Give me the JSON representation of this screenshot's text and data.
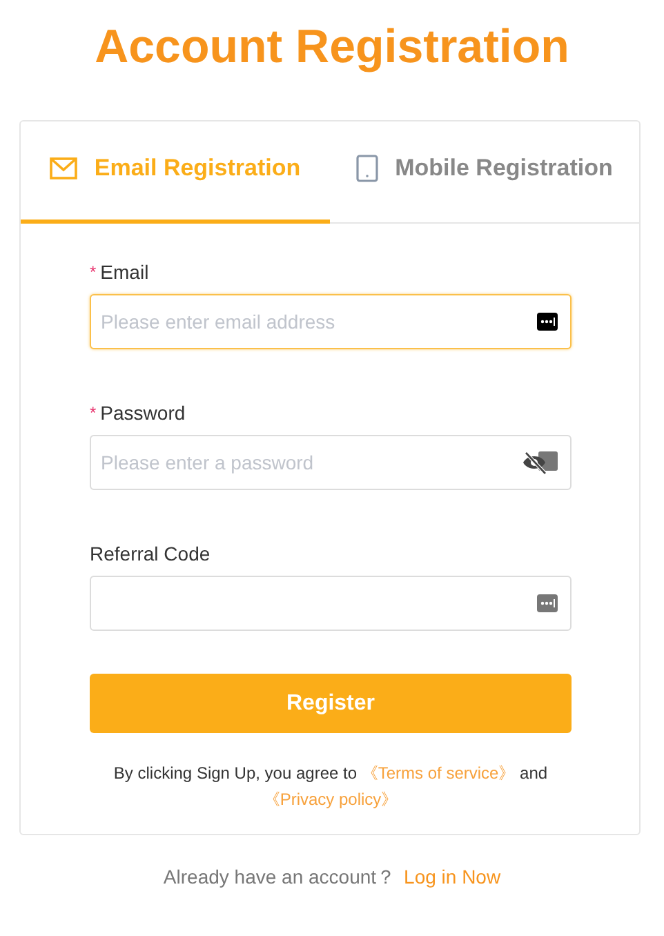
{
  "title": "Account Registration",
  "tabs": [
    {
      "label": "Email Registration",
      "selected": true
    },
    {
      "label": "Mobile Registration",
      "selected": false
    }
  ],
  "required_mark": "*",
  "fields": [
    {
      "label": "Email",
      "required": true,
      "placeholder": "Please enter email address",
      "kind": "text",
      "focused": true
    },
    {
      "label": "Password",
      "required": true,
      "placeholder": "Please enter a password",
      "kind": "password",
      "focused": false
    },
    {
      "label": "Referral Code",
      "required": false,
      "kind": "text",
      "focused": false
    }
  ],
  "submit": "Register",
  "terms": {
    "before": "By clicking Sign Up, you agree to",
    "terms_link": "《Terms of service》",
    "between": "and",
    "privacy_link": "《Privacy policy》"
  },
  "footer": {
    "question": "Already have an account？",
    "link": "Log in Now"
  }
}
